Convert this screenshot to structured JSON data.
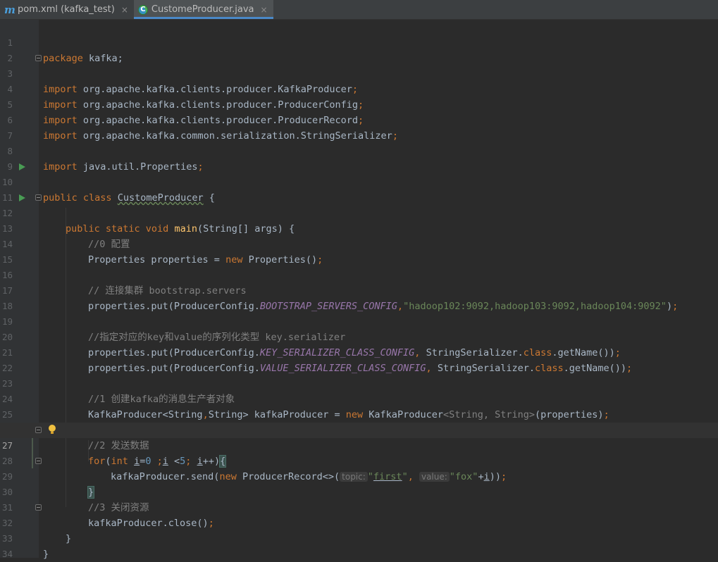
{
  "tabs": [
    {
      "icon": "maven-icon",
      "label": "pom.xml (kafka_test)",
      "active": false
    },
    {
      "icon": "java-class-icon",
      "label": "CustomeProducer.java",
      "active": true
    }
  ],
  "tab_close": "×",
  "hints": {
    "topic": "topic:",
    "value": "value:"
  },
  "lines": [
    {
      "n": "1"
    },
    {
      "n": "2"
    },
    {
      "n": "3"
    },
    {
      "n": "4"
    },
    {
      "n": "5"
    },
    {
      "n": "6"
    },
    {
      "n": "7"
    },
    {
      "n": "8"
    },
    {
      "n": "9"
    },
    {
      "n": "10"
    },
    {
      "n": "11"
    },
    {
      "n": "12"
    },
    {
      "n": "13"
    },
    {
      "n": "14"
    },
    {
      "n": "15"
    },
    {
      "n": "16"
    },
    {
      "n": "17"
    },
    {
      "n": "18"
    },
    {
      "n": "19"
    },
    {
      "n": "20"
    },
    {
      "n": "21"
    },
    {
      "n": "22"
    },
    {
      "n": "23"
    },
    {
      "n": "24"
    },
    {
      "n": "25"
    },
    {
      "n": "26"
    },
    {
      "n": "27"
    },
    {
      "n": "28"
    },
    {
      "n": "29"
    },
    {
      "n": "30"
    },
    {
      "n": "31"
    },
    {
      "n": "32"
    },
    {
      "n": "33"
    },
    {
      "n": "34"
    }
  ],
  "code": {
    "l1": [
      "package",
      " kafka;"
    ],
    "l3": [
      "import",
      " org.apache.kafka.clients.producer.KafkaProducer",
      ";"
    ],
    "l4": [
      "import",
      " org.apache.kafka.clients.producer.ProducerConfig",
      ";"
    ],
    "l5": [
      "import",
      " org.apache.kafka.clients.producer.ProducerRecord",
      ";"
    ],
    "l6": [
      "import",
      " org.apache.kafka.common.serialization.StringSerializer",
      ";"
    ],
    "l8": [
      "import",
      " java.util.Properties",
      ";"
    ],
    "l10": [
      "public class",
      " ",
      "CustomeProducer",
      " {"
    ],
    "l12": [
      "public static void",
      " ",
      "main",
      "(String[] args) {"
    ],
    "l13": [
      "//0 配置"
    ],
    "l14": [
      "Properties properties = ",
      "new",
      " Properties()",
      ";"
    ],
    "l16": [
      "// 连接集群 bootstrap.servers"
    ],
    "l17": [
      "properties.put(ProducerConfig.",
      "BOOTSTRAP_SERVERS_CONFIG",
      ",",
      "\"hadoop102:9092,hadoop103:9092,hadoop104:9092\"",
      ")",
      ";"
    ],
    "l19": [
      "//指定对应的key和value的序列化类型 key.serializer"
    ],
    "l20": [
      "properties.put(ProducerConfig.",
      "KEY_SERIALIZER_CLASS_CONFIG",
      ", ",
      "StringSerializer.",
      "class",
      ".getName())",
      ";"
    ],
    "l21": [
      "properties.put(ProducerConfig.",
      "VALUE_SERIALIZER_CLASS_CONFIG",
      ", ",
      "StringSerializer.",
      "class",
      ".getName())",
      ";"
    ],
    "l23": [
      "//1 创建kafka的消息生产者对象"
    ],
    "l24": [
      "KafkaProducer<String",
      ",",
      "String> kafkaProducer = ",
      "new",
      " KafkaProducer",
      "<String, String>",
      "(properties)",
      ";"
    ],
    "l26": [
      "//2 发送数据"
    ],
    "l27": [
      "for",
      "(",
      "int",
      " ",
      "i",
      "=",
      "0",
      " ;",
      "i",
      " <",
      "5",
      "; ",
      "i",
      "++)",
      "{"
    ],
    "l28": [
      "kafkaProducer.send(",
      "new",
      " ProducerRecord<>(",
      "\"",
      "first",
      "\"",
      ", ",
      "\"fox\"",
      "+",
      "i",
      "))",
      ";"
    ],
    "l29": [
      "}"
    ],
    "l30": [
      "//3 关闭资源"
    ],
    "l31": [
      "kafkaProducer.close()",
      ";"
    ],
    "l32": [
      "}"
    ],
    "l33": [
      "}"
    ]
  },
  "colors": {
    "keyword": "#cc7832",
    "string": "#6a8759",
    "number": "#6897bb",
    "comment": "#808080",
    "field": "#9876aa",
    "method": "#ffc66d",
    "text": "#a9b7c6",
    "background": "#2b2b2b",
    "gutter": "#313335"
  }
}
